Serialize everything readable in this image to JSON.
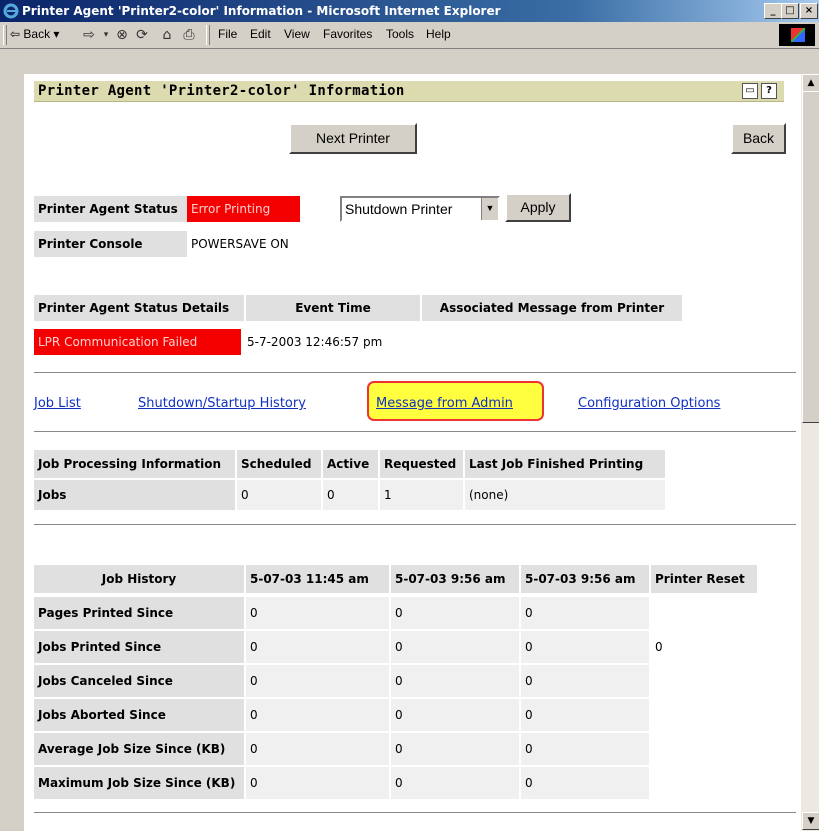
{
  "window": {
    "title": "Printer Agent 'Printer2-color' Information - Microsoft Internet Explorer"
  },
  "toolbar": {
    "back_label": "Back",
    "menus": [
      "File",
      "Edit",
      "View",
      "Favorites",
      "Tools",
      "Help"
    ]
  },
  "page": {
    "title": "Printer Agent 'Printer2-color' Information",
    "next_printer_label": "Next Printer",
    "back_label": "Back"
  },
  "status": {
    "agent_status_label": "Printer Agent Status",
    "agent_status_value": "Error Printing",
    "console_label": "Printer Console",
    "console_value": "POWERSAVE ON",
    "action_select": "Shutdown Printer",
    "apply_label": "Apply"
  },
  "details": {
    "headers": [
      "Printer Agent Status Details",
      "Event Time",
      "Associated Message from Printer"
    ],
    "row": [
      "LPR Communication Failed",
      "5-7-2003 12:46:57 pm",
      ""
    ]
  },
  "links": {
    "job_list": "Job List",
    "history": "Shutdown/Startup History",
    "admin_message": "Message from Admin",
    "config": "Configuration Options"
  },
  "job_processing": {
    "headers": [
      "Job Processing Information",
      "Scheduled",
      "Active",
      "Requested",
      "Last Job Finished Printing"
    ],
    "row": [
      "Jobs",
      "0",
      "0",
      "1",
      "(none)"
    ]
  },
  "job_history": {
    "headers": [
      "Job History",
      "5-07-03 11:45 am",
      "5-07-03 9:56 am",
      "5-07-03 9:56 am",
      "Printer Reset"
    ],
    "rows": [
      [
        "Pages Printed Since",
        "0",
        "0",
        "0",
        ""
      ],
      [
        "Jobs Printed Since",
        "0",
        "0",
        "0",
        "0"
      ],
      [
        "Jobs Canceled Since",
        "0",
        "0",
        "0",
        ""
      ],
      [
        "Jobs Aborted Since",
        "0",
        "0",
        "0",
        ""
      ],
      [
        "Average Job Size Since (KB)",
        "0",
        "0",
        "0",
        ""
      ],
      [
        "Maximum Job Size Since (KB)",
        "0",
        "0",
        "0",
        ""
      ]
    ]
  },
  "colors": {
    "error_red": "#f40000",
    "highlight": "#ffff40",
    "link": "#1030c0",
    "header_bar": "#dcdbb0"
  }
}
